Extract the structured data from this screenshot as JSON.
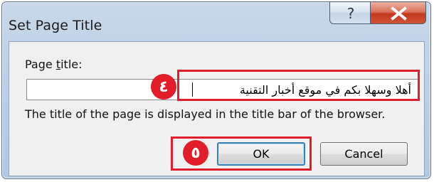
{
  "window": {
    "title": "Set Page Title"
  },
  "caption_buttons": {
    "help": "?",
    "close": "x"
  },
  "form": {
    "label_prefix": "Page ",
    "label_underlined": "t",
    "label_suffix": "itle:",
    "input_value": "أهلا وسهلا بكم في موقع أخبار التقنية",
    "hint": "The title of the page is displayed in the title bar of the browser."
  },
  "buttons": {
    "ok": "OK",
    "cancel": "Cancel"
  },
  "annotations": {
    "step4": "٤",
    "step5": "٥",
    "highlight_color": "#e11d2a"
  }
}
